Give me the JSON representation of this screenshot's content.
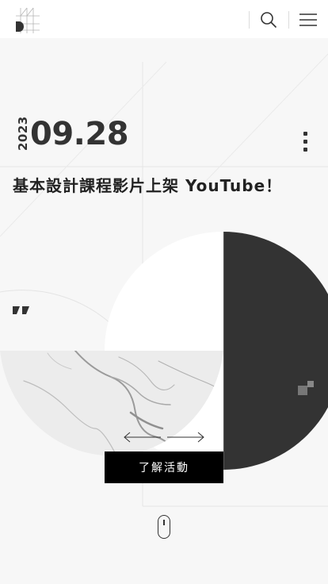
{
  "header": {
    "logo_icon": "brand-logo-icon",
    "search_icon": "search-icon",
    "menu_icon": "hamburger-menu-icon"
  },
  "news": {
    "year": "2023",
    "day": "09.28",
    "title": "基本設計課程影片上架 YouTube！",
    "more_icon": "vertical-dots-icon"
  },
  "carousel": {
    "prev_icon": "arrow-left-icon",
    "next_icon": "arrow-right-icon",
    "cta_label": "了解活動"
  },
  "colors": {
    "dark": "#333333",
    "accent_black": "#000000",
    "background": "#f7f7f7"
  },
  "scroll_hint_icon": "mouse-scroll-icon"
}
